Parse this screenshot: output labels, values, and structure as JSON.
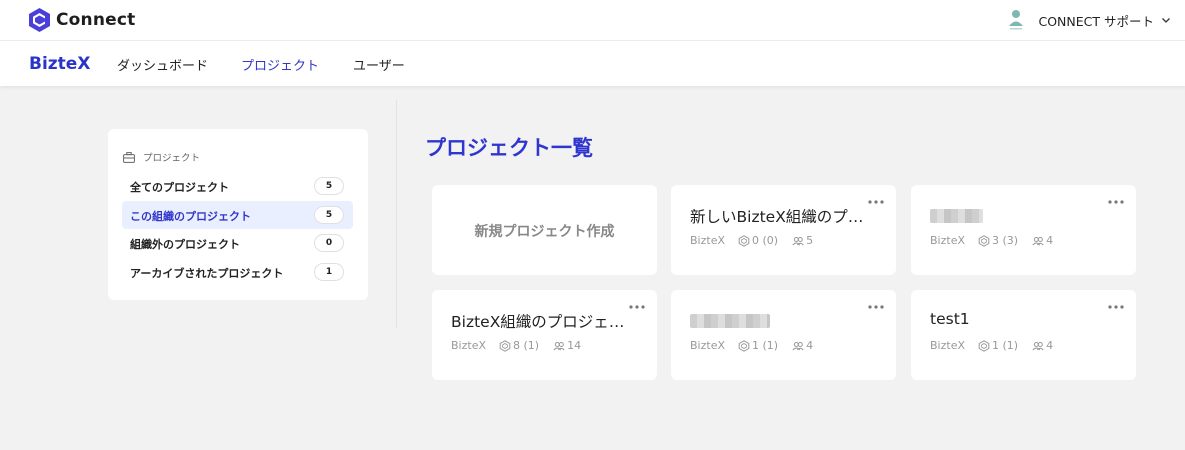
{
  "app": {
    "name": "Connect"
  },
  "user": {
    "name": "CONNECT サポート"
  },
  "org": {
    "logo_text": "BizteX"
  },
  "nav": {
    "items": [
      {
        "label": "ダッシュボード",
        "active": false
      },
      {
        "label": "プロジェクト",
        "active": true
      },
      {
        "label": "ユーザー",
        "active": false
      }
    ]
  },
  "sidebar": {
    "heading": "プロジェクト",
    "items": [
      {
        "label": "全てのプロジェクト",
        "count": "5",
        "active": false
      },
      {
        "label": "この組織のプロジェクト",
        "count": "5",
        "active": true
      },
      {
        "label": "組織外のプロジェクト",
        "count": "0",
        "active": false
      },
      {
        "label": "アーカイブされたプロジェクト",
        "count": "1",
        "active": false
      }
    ]
  },
  "main": {
    "title": "プロジェクト一覧",
    "new_card_label": "新規プロジェクト作成",
    "projects": [
      {
        "title": "新しいBizteX組織のプロジェクト",
        "org": "BizteX",
        "robots": "0 (0)",
        "members": "5",
        "redacted": false
      },
      {
        "title": "",
        "org": "BizteX",
        "robots": "3 (3)",
        "members": "4",
        "redacted": true
      },
      {
        "title": "BizteX組織のプロジェクト",
        "org": "BizteX",
        "robots": "8 (1)",
        "members": "14",
        "redacted": false
      },
      {
        "title": "",
        "org": "BizteX",
        "robots": "1 (1)",
        "members": "4",
        "redacted": true
      },
      {
        "title": "test1",
        "org": "BizteX",
        "robots": "1 (1)",
        "members": "4",
        "redacted": false
      }
    ]
  },
  "colors": {
    "accent": "#2f36cf",
    "active_bg": "#e9efff",
    "background": "#f2f2f2"
  }
}
